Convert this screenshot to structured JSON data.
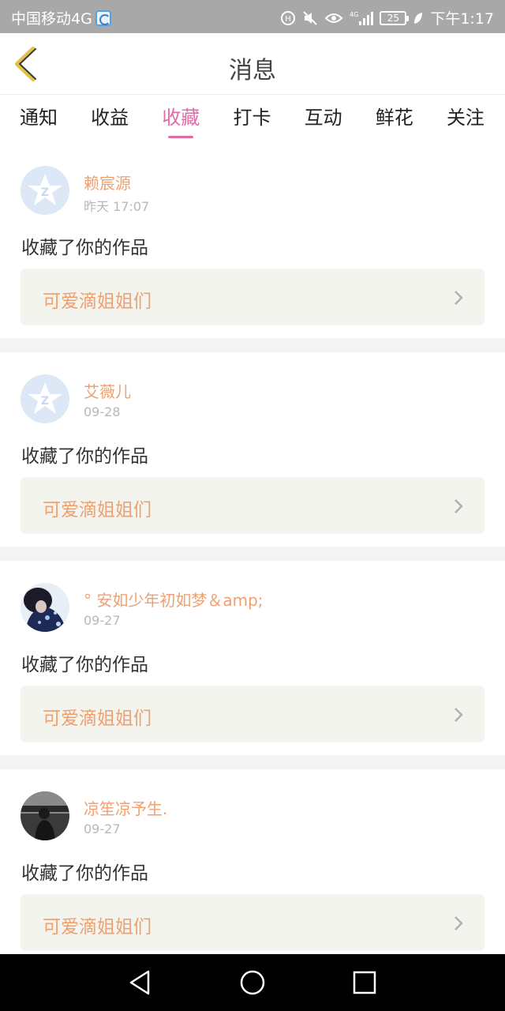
{
  "status_bar": {
    "carrier": "中国移动4G",
    "battery": "25",
    "time": "下午1:17"
  },
  "header": {
    "title": "消息",
    "back_icon": "chevron-left-icon"
  },
  "tabs": [
    {
      "label": "通知"
    },
    {
      "label": "收益"
    },
    {
      "label": "收藏",
      "active": true
    },
    {
      "label": "打卡"
    },
    {
      "label": "互动"
    },
    {
      "label": "鲜花"
    },
    {
      "label": "关注"
    }
  ],
  "messages": [
    {
      "name": "赖宸源",
      "time": "昨天 17:07",
      "action": "收藏了你的作品",
      "work_title": "可爱滴姐姐们",
      "avatar": "qzone-default-avatar"
    },
    {
      "name": "艾薇儿",
      "time": "09-28",
      "action": "收藏了你的作品",
      "work_title": "可爱滴姐姐们",
      "avatar": "qzone-default-avatar"
    },
    {
      "name": "° 安如少年初如梦＆amp;",
      "time": "09-27",
      "action": "收藏了你的作品",
      "work_title": "可爱滴姐姐们",
      "avatar": "photo-avatar-girl"
    },
    {
      "name": "凉笙凉予生.",
      "time": "09-27",
      "action": "收藏了你的作品",
      "work_title": "可爱滴姐姐们",
      "avatar": "photo-avatar-boy"
    }
  ],
  "colors": {
    "accent": "#e46aa6",
    "name": "#f0a070",
    "card_bg": "#f4f4ee",
    "status_bar": "#a8a8a8"
  }
}
